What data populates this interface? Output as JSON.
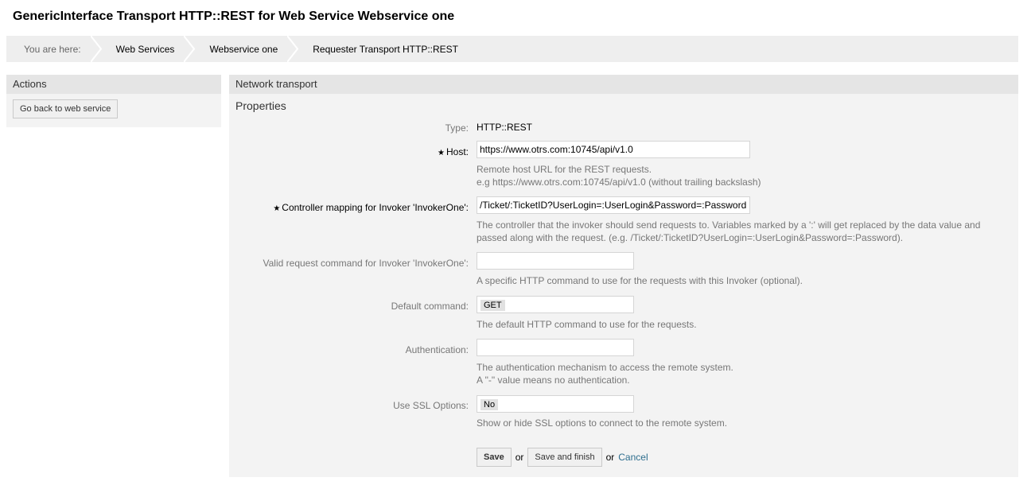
{
  "page": {
    "title": "GenericInterface Transport HTTP::REST for Web Service Webservice one"
  },
  "breadcrumb": {
    "prefix": "You are here:",
    "items": [
      "Web Services",
      "Webservice one",
      "Requester Transport HTTP::REST"
    ]
  },
  "sidebar": {
    "header": "Actions",
    "back_button": "Go back to web service"
  },
  "main": {
    "header": "Network transport",
    "section": "Properties",
    "fields": {
      "type": {
        "label": "Type:",
        "value": "HTTP::REST"
      },
      "host": {
        "label": "Host:",
        "required": true,
        "value": "https://www.otrs.com:10745/api/v1.0",
        "help": [
          "Remote host URL for the REST requests.",
          "e.g https://www.otrs.com:10745/api/v1.0 (without trailing backslash)"
        ]
      },
      "controller": {
        "label": "Controller mapping for Invoker 'InvokerOne':",
        "required": true,
        "value": "/Ticket/:TicketID?UserLogin=:UserLogin&Password=:Password",
        "help": [
          "The controller that the invoker should send requests to. Variables marked by a ':' will get replaced by the data value and",
          "passed along with the request. (e.g. /Ticket/:TicketID?UserLogin=:UserLogin&Password=:Password)."
        ]
      },
      "valid_command": {
        "label": "Valid request command for Invoker 'InvokerOne':",
        "value": "",
        "help": "A specific HTTP command to use for the requests with this Invoker (optional)."
      },
      "default_command": {
        "label": "Default command:",
        "value": "GET",
        "help": "The default HTTP command to use for the requests."
      },
      "authentication": {
        "label": "Authentication:",
        "value": "",
        "help": [
          "The authentication mechanism to access the remote system.",
          "A \"-\" value means no authentication."
        ]
      },
      "ssl": {
        "label": "Use SSL Options:",
        "value": "No",
        "help": "Show or hide SSL options to connect to the remote system."
      }
    },
    "actions": {
      "save": "Save",
      "or1": "or",
      "save_finish": "Save and finish",
      "or2": "or",
      "cancel": "Cancel"
    }
  },
  "required_marker": "★"
}
